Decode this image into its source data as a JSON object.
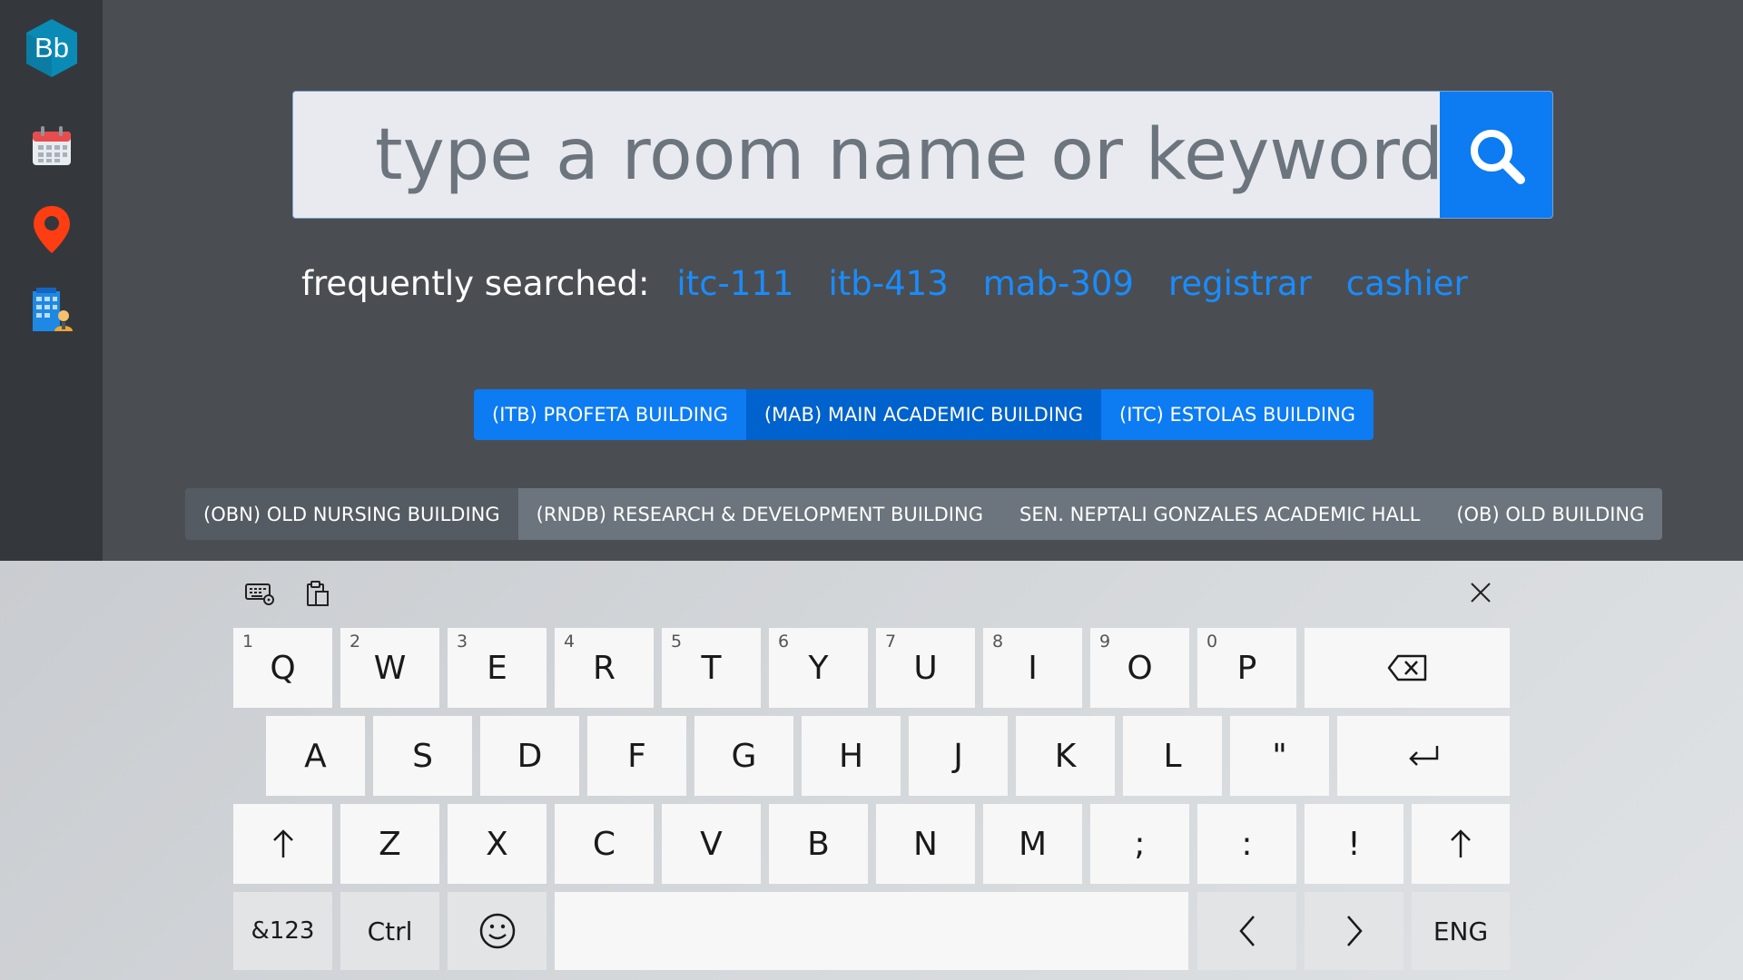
{
  "sidebar": {
    "logo_text": "Bb",
    "items": [
      {
        "icon": "calendar-icon"
      },
      {
        "icon": "map-pin-icon"
      },
      {
        "icon": "building-icon"
      }
    ]
  },
  "search": {
    "placeholder": "type a room name or keyword",
    "value": "",
    "button_icon": "search-icon"
  },
  "frequently": {
    "label": "frequently searched:",
    "links": [
      "itc-111",
      "itb-413",
      "mab-309",
      "registrar",
      "cashier"
    ]
  },
  "buildings": {
    "row1": [
      "(ITB) PROFETA BUILDING",
      "(MAB) MAIN ACADEMIC BUILDING",
      "(ITC) ESTOLAS BUILDING"
    ],
    "row2": [
      "(OBN) OLD NURSING BUILDING",
      "(RNDB) RESEARCH & DEVELOPMENT BUILDING",
      "SEN. NEPTALI GONZALES ACADEMIC HALL",
      "(OB) OLD BUILDING"
    ]
  },
  "keyboard": {
    "toolbar": [
      "keyboard-settings-icon",
      "clipboard-icon",
      "close-icon"
    ],
    "row1": [
      {
        "label": "Q",
        "num": "1"
      },
      {
        "label": "W",
        "num": "2"
      },
      {
        "label": "E",
        "num": "3"
      },
      {
        "label": "R",
        "num": "4"
      },
      {
        "label": "T",
        "num": "5"
      },
      {
        "label": "Y",
        "num": "6"
      },
      {
        "label": "U",
        "num": "7"
      },
      {
        "label": "I",
        "num": "8"
      },
      {
        "label": "O",
        "num": "9"
      },
      {
        "label": "P",
        "num": "0"
      }
    ],
    "row2": [
      "A",
      "S",
      "D",
      "F",
      "G",
      "H",
      "J",
      "K",
      "L",
      "\""
    ],
    "row3": [
      "Z",
      "X",
      "C",
      "V",
      "B",
      "N",
      "M",
      ";",
      ":",
      "!"
    ],
    "row4": {
      "symbols": "&123",
      "ctrl": "Ctrl",
      "lang": "ENG"
    }
  },
  "colors": {
    "accent": "#0d7bf2",
    "page_bg": "#4a4e52",
    "sidebar_bg": "#34383d",
    "secondary": "#6c757d"
  }
}
